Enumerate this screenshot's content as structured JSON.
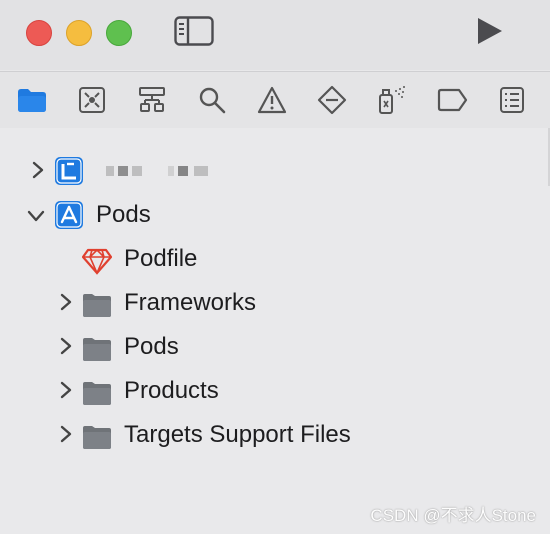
{
  "window": {
    "traffic_lights": {
      "close": "#ed5a55",
      "minimize": "#f5bd3f",
      "zoom": "#5fc04f"
    }
  },
  "navigator_tabs": [
    {
      "icon": "folder-icon",
      "active": true
    },
    {
      "icon": "source-control-icon"
    },
    {
      "icon": "symbol-hierarchy-icon"
    },
    {
      "icon": "search-icon"
    },
    {
      "icon": "warning-icon"
    },
    {
      "icon": "test-diamond-icon"
    },
    {
      "icon": "debug-spray-icon"
    },
    {
      "icon": "breakpoint-tag-icon"
    },
    {
      "icon": "report-list-icon"
    }
  ],
  "tree": {
    "project_name": "",
    "pods_project": "Pods",
    "podfile": "Podfile",
    "groups": [
      "Frameworks",
      "Pods",
      "Products",
      "Targets Support Files"
    ]
  },
  "watermark": "CSDN @不求人Stone",
  "colors": {
    "accent": "#1f7ae0",
    "ruby": "#e0402f",
    "folder": "#6f7378"
  }
}
